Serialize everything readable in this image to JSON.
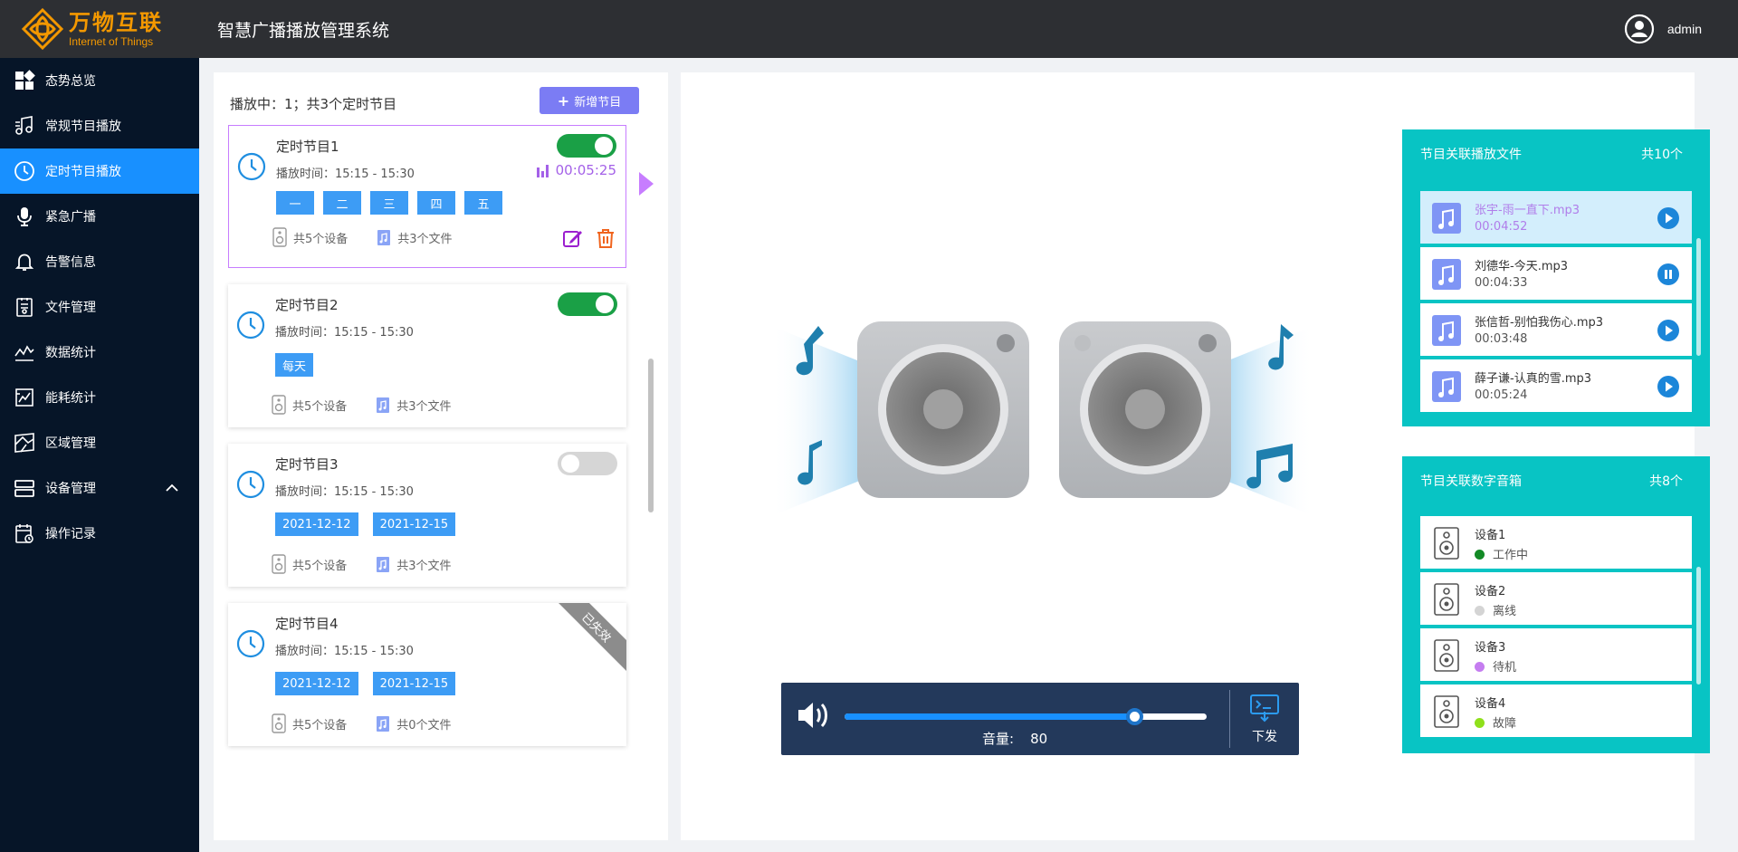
{
  "header": {
    "logo_cn": "万物互联",
    "logo_en": "Internet of Things",
    "system_title": "智慧广播播放管理系统",
    "user_name": "admin"
  },
  "sidebar": {
    "items": [
      {
        "label": "态势总览",
        "icon": "dashboard-icon",
        "active": false
      },
      {
        "label": "常规节目播放",
        "icon": "music-note-icon",
        "active": false
      },
      {
        "label": "定时节目播放",
        "icon": "clock-icon",
        "active": true
      },
      {
        "label": "紧急广播",
        "icon": "microphone-icon",
        "active": false
      },
      {
        "label": "告警信息",
        "icon": "bell-icon",
        "active": false
      },
      {
        "label": "文件管理",
        "icon": "file-icon",
        "active": false
      },
      {
        "label": "数据统计",
        "icon": "line-chart-icon",
        "active": false
      },
      {
        "label": "能耗统计",
        "icon": "energy-chart-icon",
        "active": false
      },
      {
        "label": "区域管理",
        "icon": "map-icon",
        "active": false
      },
      {
        "label": "设备管理",
        "icon": "device-icon",
        "active": false
      },
      {
        "label": "操作记录",
        "icon": "calendar-log-icon",
        "active": false
      }
    ]
  },
  "programs": {
    "status_text": "播放中：1；共3个定时节目",
    "add_label": "新增节目",
    "cards": [
      {
        "name": "定时节目1",
        "time": "播放时间：15:15 - 15:30",
        "tags": [
          "一",
          "二",
          "三",
          "四",
          "五"
        ],
        "devices": "共5个设备",
        "files": "共3个文件",
        "enabled": true,
        "elapsed": "00:05:25"
      },
      {
        "name": "定时节目2",
        "time": "播放时间：15:15 - 15:30",
        "tags": [
          "每天"
        ],
        "devices": "共5个设备",
        "files": "共3个文件",
        "enabled": true
      },
      {
        "name": "定时节目3",
        "time": "播放时间：15:15 - 15:30",
        "tags": [
          "2021-12-12",
          "2021-12-15"
        ],
        "devices": "共5个设备",
        "files": "共3个文件",
        "enabled": false
      },
      {
        "name": "定时节目4",
        "time": "播放时间：15:15 - 15:30",
        "tags": [
          "2021-12-12",
          "2021-12-15"
        ],
        "devices": "共5个设备",
        "files": "共0个文件",
        "expired_label": "已失效"
      }
    ]
  },
  "player": {
    "volume_label": "音量:",
    "volume_value": "80",
    "volume_fraction": 0.8,
    "send_label": "下发"
  },
  "files_panel": {
    "title": "节目关联播放文件",
    "count_prefix": "共",
    "count": "10",
    "count_suffix": "个",
    "items": [
      {
        "name": "张宇-雨一直下.mp3",
        "duration": "00:04:52",
        "state": "playing-selected"
      },
      {
        "name": "刘德华-今天.mp3",
        "duration": "00:04:33",
        "state": "paused"
      },
      {
        "name": "张信哲-别怕我伤心.mp3",
        "duration": "00:03:48",
        "state": "play"
      },
      {
        "name": "薛子谦-认真的雪.mp3",
        "duration": "00:05:24",
        "state": "play"
      }
    ]
  },
  "devices_panel": {
    "title": "节目关联数字音箱",
    "count_prefix": "共",
    "count": "8",
    "count_suffix": "个",
    "items": [
      {
        "name": "设备1",
        "status": "工作中",
        "color": "#138a26"
      },
      {
        "name": "设备2",
        "status": "离线",
        "color": "#d4d4d4"
      },
      {
        "name": "设备3",
        "status": "待机",
        "color": "#c57df0"
      },
      {
        "name": "设备4",
        "status": "故障",
        "color": "#8fe01b"
      }
    ]
  },
  "colors": {
    "active_nav": "#1890ff",
    "header_bg": "#2d2f33",
    "sidebar_bg": "#061528",
    "panel_teal": "#08c4c4",
    "toggle_on": "#1aa046",
    "tag_blue": "#3d9cf5",
    "accent_purple": "#a461e8"
  }
}
